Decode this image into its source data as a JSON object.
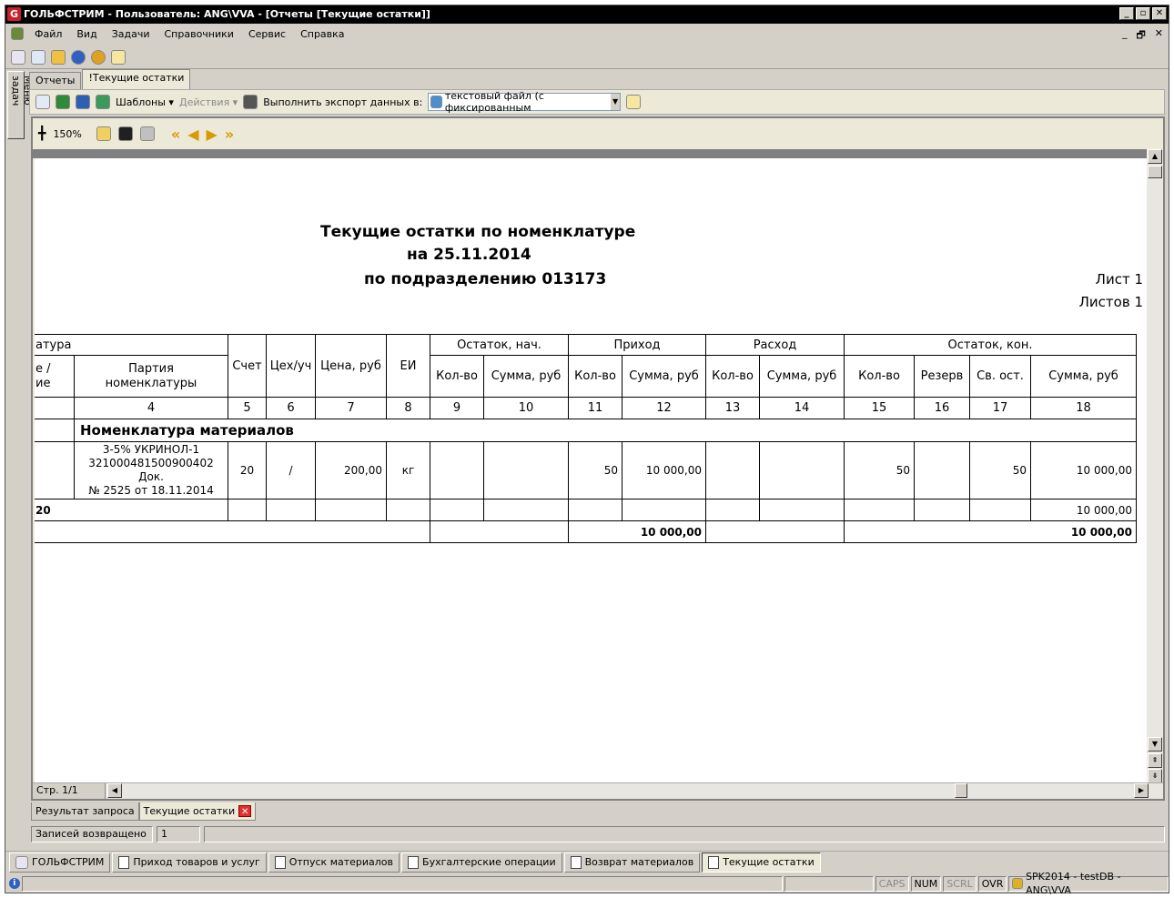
{
  "window": {
    "title": "ГОЛЬФСТРИМ - Пользователь: ANG\\VVA - [Отчеты  [Текущие остатки]]",
    "app_icon": "G"
  },
  "menu": [
    "Файл",
    "Вид",
    "Задачи",
    "Справочники",
    "Сервис",
    "Справка"
  ],
  "side_panel": {
    "label": "Меню задач"
  },
  "tabs": [
    "Отчеты",
    "!Текущие остатки"
  ],
  "toolbar2": {
    "templates": "Шаблоны",
    "actions": "Действия",
    "export_label": "Выполнить экспорт данных в:",
    "export_format": "текстовый файл (с фиксированным"
  },
  "viewer": {
    "zoom": "150%",
    "page_info": "Стр. 1/1"
  },
  "report": {
    "title1": "Текущие остатки по номенклатуре",
    "title2": "на  25.11.2014",
    "title3": "по подразделению 013173",
    "sheet": "Лист 1",
    "sheets": "Листов 1",
    "header": {
      "nomen": "атура",
      "nomen_sub": "е /\nие",
      "party": "Партия\nноменклатуры",
      "account": "Счет",
      "shop": "Цех/уч",
      "price": "Цена, руб",
      "unit": "ЕИ",
      "start": "Остаток, нач.",
      "income": "Приход",
      "expense": "Расход",
      "end": "Остаток, кон.",
      "qty": "Кол-во",
      "sum": "Сумма, руб",
      "reserve": "Резерв",
      "free": "Св. ост."
    },
    "colnums": [
      "4",
      "5",
      "6",
      "7",
      "8",
      "9",
      "10",
      "11",
      "12",
      "13",
      "14",
      "15",
      "16",
      "17",
      "18"
    ],
    "group": "Номенклатура материалов",
    "row": {
      "party": "3-5% УКРИНОЛ-1\n321000481500900402 Док.\n№ 2525 от 18.11.2014",
      "account": "20",
      "shop": "/",
      "price": "200,00",
      "unit": "кг",
      "inc_qty": "50",
      "inc_sum": "10 000,00",
      "end_qty": "50",
      "free": "50",
      "end_sum": "10 000,00"
    },
    "subtotal": {
      "label": "20",
      "end_sum": "10 000,00"
    },
    "total": {
      "inc_sum": "10 000,00",
      "end_sum": "10 000,00"
    }
  },
  "bottom_tabs": [
    "Результат запроса",
    "Текущие остатки"
  ],
  "status": {
    "label": "Записей возвращено",
    "value": "1"
  },
  "taskbar": [
    "ГОЛЬФСТРИМ",
    "Приход товаров и услуг",
    "Отпуск материалов",
    "Бухгалтерские операции",
    "Возврат материалов",
    "Текущие остатки"
  ],
  "bottom_status": {
    "caps": "CAPS",
    "num": "NUM",
    "scrl": "SCRL",
    "ovr": "OVR",
    "db": "SPK2014 - testDB - ANG\\VVA"
  }
}
